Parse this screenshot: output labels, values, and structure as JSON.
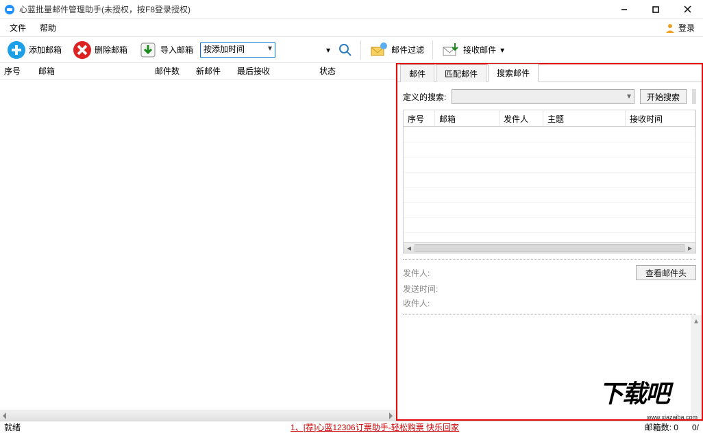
{
  "titlebar": {
    "title": "心蓝批量邮件管理助手(未授权，按F8登录授权)"
  },
  "menubar": {
    "file": "文件",
    "help": "帮助",
    "login": "登录"
  },
  "toolbar": {
    "add_mailbox": "添加邮箱",
    "delete_mailbox": "删除邮箱",
    "import_mailbox": "导入邮箱",
    "sort_select": "按添加时间",
    "mail_filter": "邮件过滤",
    "receive_mail": "接收邮件"
  },
  "left_columns": {
    "c1": "序号",
    "c2": "邮箱",
    "c3": "邮件数",
    "c4": "新邮件",
    "c5": "最后接收",
    "c6": "状态"
  },
  "tabs": {
    "mail": "邮件",
    "match": "匹配邮件",
    "search": "搜索邮件"
  },
  "search": {
    "label": "定义的搜索:",
    "start_btn": "开始搜索"
  },
  "result_columns": {
    "c1": "序号",
    "c2": "邮箱",
    "c3": "发件人",
    "c4": "主题",
    "c5": "接收时间"
  },
  "detail": {
    "sender": "发件人:",
    "send_time": "发送时间:",
    "recipient": "收件人:",
    "view_header_btn": "查看邮件头"
  },
  "statusbar": {
    "ready": "就绪",
    "promo": "1、[荐]心蓝12306订票助手-轻松购票 快乐回家",
    "mailbox_count_label": "邮箱数: 0",
    "part": "0/"
  },
  "watermark": {
    "text": "下载吧",
    "url": "www.xiazaiba.com"
  }
}
